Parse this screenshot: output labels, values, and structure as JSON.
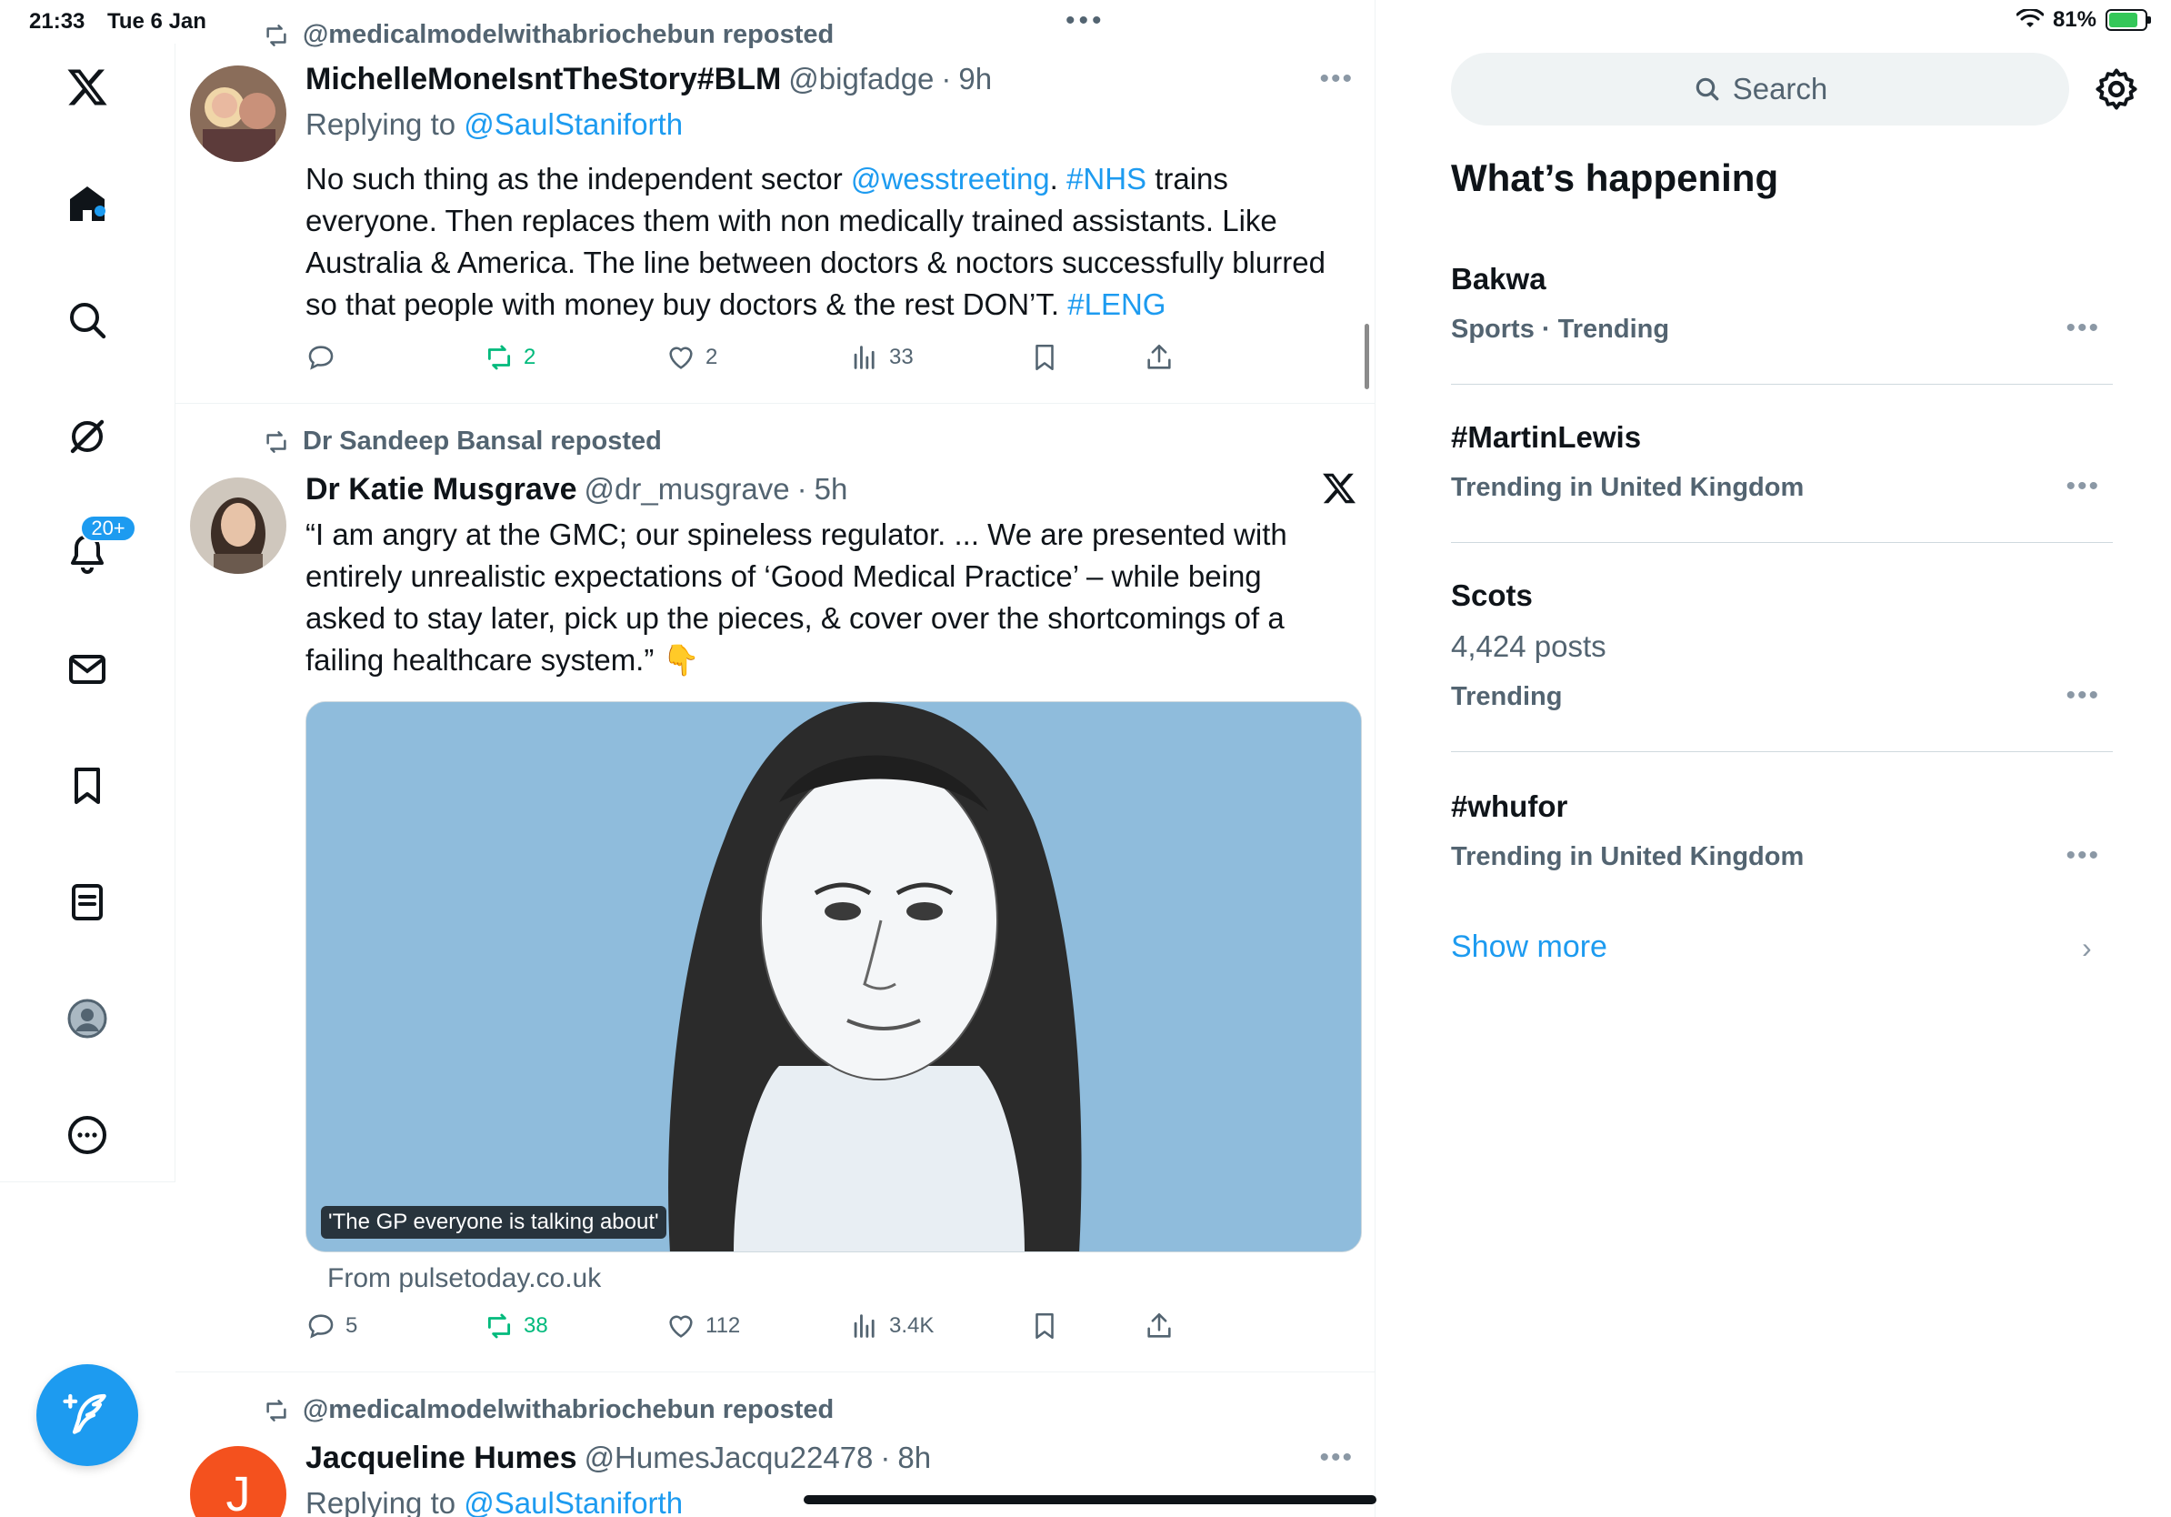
{
  "status_bar": {
    "time": "21:33",
    "date": "Tue 6 Jan",
    "battery": "81%"
  },
  "nav": {
    "items": [
      "x-logo",
      "home",
      "search",
      "grok",
      "notifications",
      "messages",
      "bookmarks",
      "lists",
      "profile",
      "more"
    ],
    "notifications_badge": "20+"
  },
  "timeline": {
    "posts": [
      {
        "repost_by": "@medicalmodelwithabriochebun reposted",
        "name": "MichelleMoneIsntTheStory#BLM",
        "handle": "@bigfadge",
        "dot": "·",
        "time": "9h",
        "reply_prefix": "Replying to ",
        "reply_to": "@SaulStaniforth",
        "text_parts": [
          "No such thing as the independent sector ",
          "@wesstreeting",
          ".  ",
          "#NHS",
          " trains everyone. Then replaces them with non medically trained assistants. Like Australia & America. The line between doctors & noctors successfully blurred so that people with money buy doctors & the rest DON’T. ",
          "#LENG"
        ],
        "replies": "",
        "reposts": "2",
        "likes": "2",
        "views": "33"
      },
      {
        "repost_by": "Dr Sandeep Bansal reposted",
        "name": "Dr Katie Musgrave",
        "handle": "@dr_musgrave",
        "dot": "·",
        "time": "5h",
        "text": "“I am angry at the GMC; our spineless regulator. ... We are presented with entirely unrealistic expectations of ‘Good Medical Practice’ – while being asked to stay later, pick up the pieces, & cover over the shortcomings of a failing healthcare system.” 👇",
        "media_caption": "'The GP everyone is talking about'",
        "media_source": "From pulsetoday.co.uk",
        "replies": "5",
        "reposts": "38",
        "likes": "112",
        "views": "3.4K"
      },
      {
        "repost_by": "@medicalmodelwithabriochebun reposted",
        "name": "Jacqueline Humes",
        "handle": "@HumesJacqu22478",
        "dot": "·",
        "time": "8h",
        "avatar_letter": "J",
        "reply_prefix": "Replying to ",
        "reply_to": "@SaulStaniforth"
      }
    ]
  },
  "sidebar": {
    "search_placeholder": "Search",
    "title": "What’s happening",
    "trends": [
      {
        "name": "Bakwa",
        "meta": "Sports · Trending"
      },
      {
        "name": "#MartinLewis",
        "meta": "Trending in United Kingdom"
      },
      {
        "name": "Scots",
        "count": "4,424 posts",
        "meta": "Trending"
      },
      {
        "name": "#whufor",
        "meta": "Trending in United Kingdom"
      }
    ],
    "show_more": "Show more"
  },
  "colors": {
    "accent": "#1d9bf0",
    "repost_green": "#00ba7c",
    "muted": "#536471"
  }
}
